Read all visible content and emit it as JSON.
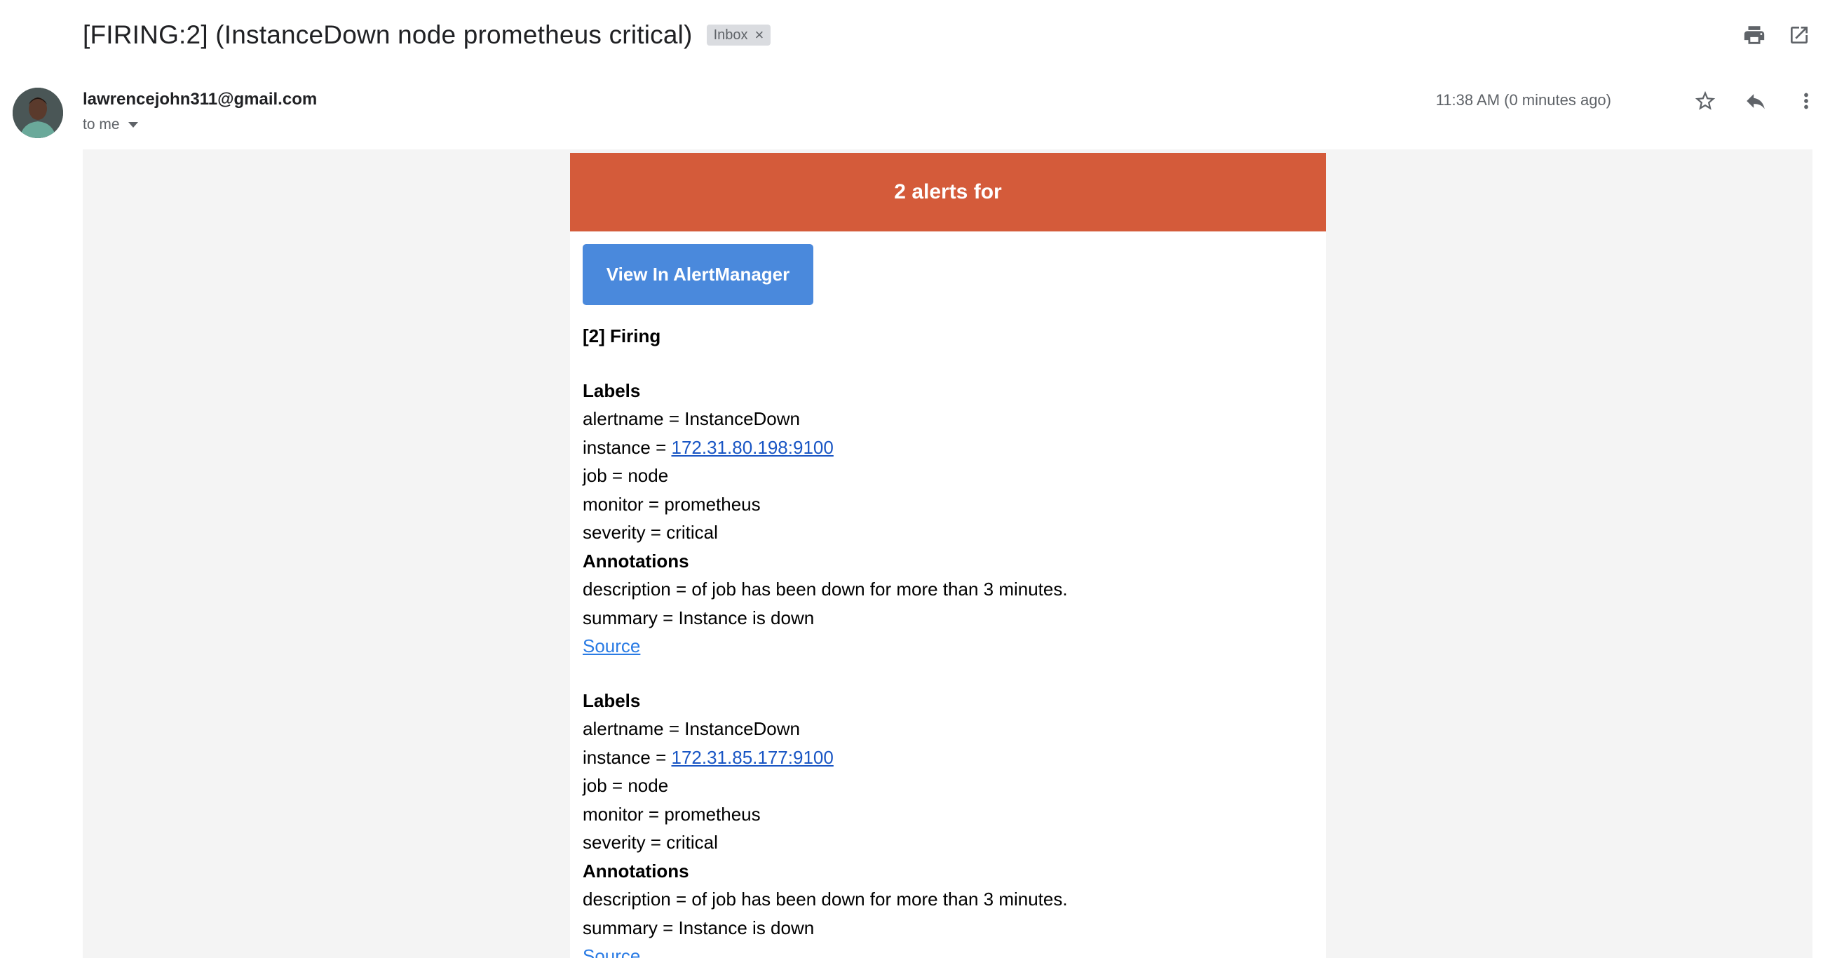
{
  "email": {
    "subject": "[FIRING:2] (InstanceDown node prometheus critical)",
    "label_chip": "Inbox",
    "sender": "lawrencejohn311@gmail.com",
    "recipient": "to me",
    "timestamp": "11:38 AM (0 minutes ago)"
  },
  "icons": {
    "print": "print-icon",
    "open_new_window": "open-in-new-icon",
    "star": "star-icon",
    "reply": "reply-icon",
    "more": "more-vert-icon",
    "chip_close": "close-icon"
  },
  "colors": {
    "banner": "#d45b3a",
    "button": "#4a89dc",
    "canvas": "#f4f4f4",
    "link": "#1a56c4"
  },
  "alert_email": {
    "banner_text": "2 alerts for",
    "button_label": "View In AlertManager",
    "firing_heading": "[2] Firing",
    "alerts": [
      {
        "labels_heading": "Labels",
        "alertname": "alertname = InstanceDown",
        "instance_prefix": "instance = ",
        "instance_value": "172.31.80.198:9100",
        "job": "job = node",
        "monitor": "monitor = prometheus",
        "severity": "severity = critical",
        "annotations_heading": "Annotations",
        "description": "description = of job has been down for more than 3 minutes.",
        "summary": "summary = Instance is down",
        "source": "Source"
      },
      {
        "labels_heading": "Labels",
        "alertname": "alertname = InstanceDown",
        "instance_prefix": "instance = ",
        "instance_value": "172.31.85.177:9100",
        "job": "job = node",
        "monitor": "monitor = prometheus",
        "severity": "severity = critical",
        "annotations_heading": "Annotations",
        "description": "description = of job has been down for more than 3 minutes.",
        "summary": "summary = Instance is down",
        "source": "Source"
      }
    ]
  }
}
